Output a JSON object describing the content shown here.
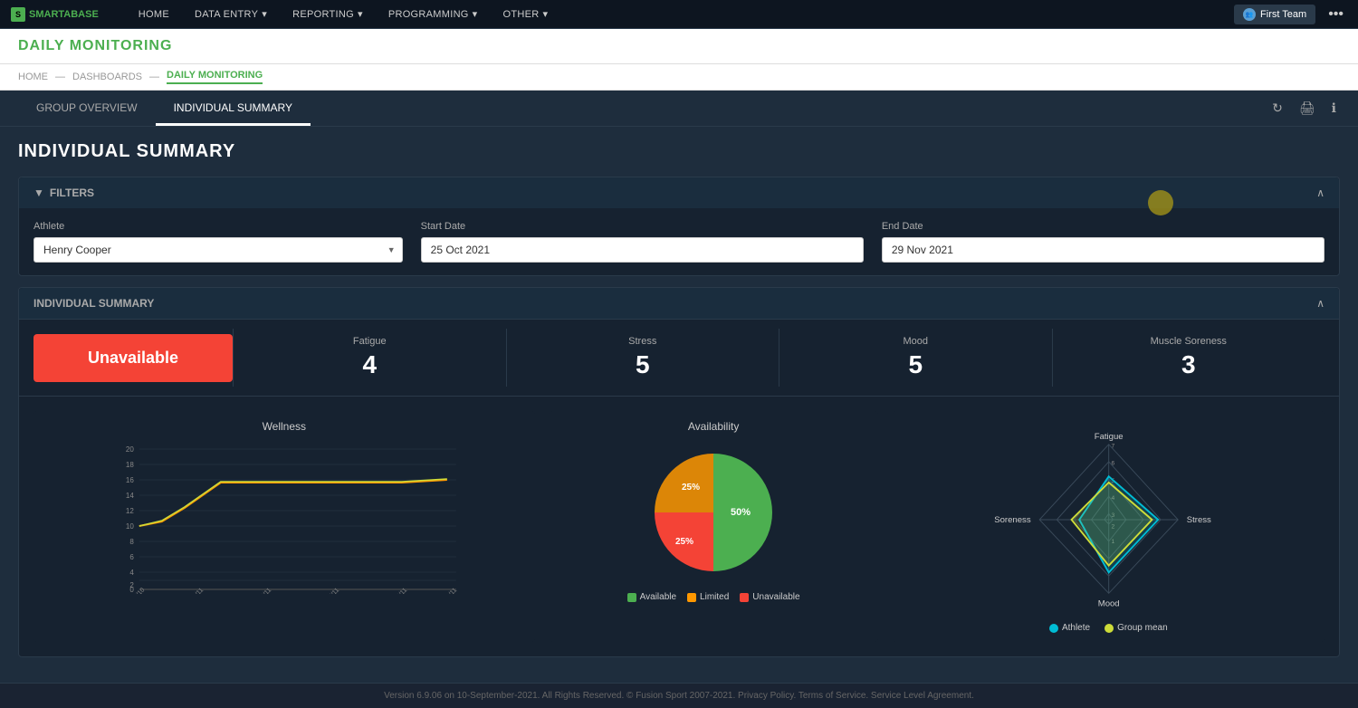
{
  "nav": {
    "logo": "SMARTABASE",
    "items": [
      {
        "label": "HOME",
        "hasDropdown": false
      },
      {
        "label": "DATA ENTRY",
        "hasDropdown": true
      },
      {
        "label": "REPORTING",
        "hasDropdown": true
      },
      {
        "label": "PROGRAMMING",
        "hasDropdown": true
      },
      {
        "label": "OTHER",
        "hasDropdown": true
      }
    ],
    "team_btn": "First Team",
    "dots": "•••"
  },
  "page": {
    "title": "DAILY MONITORING",
    "breadcrumbs": [
      "HOME",
      "DASHBOARDS",
      "DAILY MONITORING"
    ]
  },
  "tabs": {
    "items": [
      {
        "label": "GROUP OVERVIEW"
      },
      {
        "label": "INDIVIDUAL SUMMARY"
      }
    ],
    "active": 1
  },
  "section_title": "INDIVIDUAL SUMMARY",
  "filters": {
    "title": "FILTERS",
    "athlete_label": "Athlete",
    "athlete_value": "Henry Cooper",
    "start_date_label": "Start Date",
    "start_date_value": "25 Oct 2021",
    "end_date_label": "End Date",
    "end_date_value": "29 Nov 2021"
  },
  "summary": {
    "title": "INDIVIDUAL SUMMARY",
    "unavailable_label": "Unavailable",
    "metrics": [
      {
        "label": "Fatigue",
        "value": "4"
      },
      {
        "label": "Stress",
        "value": "5"
      },
      {
        "label": "Mood",
        "value": "5"
      },
      {
        "label": "Muscle Soreness",
        "value": "3"
      }
    ]
  },
  "wellness_chart": {
    "title": "Wellness",
    "y_labels": [
      "20",
      "18",
      "16",
      "14",
      "12",
      "10",
      "8",
      "6",
      "4",
      "2",
      "0"
    ],
    "x_labels": [
      "25/10",
      "01/11",
      "08/11",
      "15/11",
      "22/11",
      "29/11"
    ]
  },
  "availability_chart": {
    "title": "Availability",
    "segments": [
      {
        "label": "Available",
        "value": 50,
        "percent": "50%",
        "color": "#4caf50"
      },
      {
        "label": "Limited",
        "value": 25,
        "percent": "25%",
        "color": "#ff9800"
      },
      {
        "label": "Unavailable",
        "value": 25,
        "percent": "25%",
        "color": "#f44336"
      }
    ]
  },
  "radar_chart": {
    "title": "",
    "labels": {
      "top": "Fatigue",
      "right": "Stress",
      "bottom": "Mood",
      "left": "Soreness"
    },
    "scale_labels": [
      "7",
      "6",
      "5",
      "4",
      "3",
      "2",
      "1"
    ],
    "legend": [
      {
        "label": "Athlete",
        "color": "#00bcd4"
      },
      {
        "label": "Group mean",
        "color": "#cddc39"
      }
    ]
  },
  "footer": {
    "text": "Version 6.9.06 on 10-September-2021. All Rights Reserved. © Fusion Sport 2007-2021. Privacy Policy. Terms of Service. Service Level Agreement."
  }
}
